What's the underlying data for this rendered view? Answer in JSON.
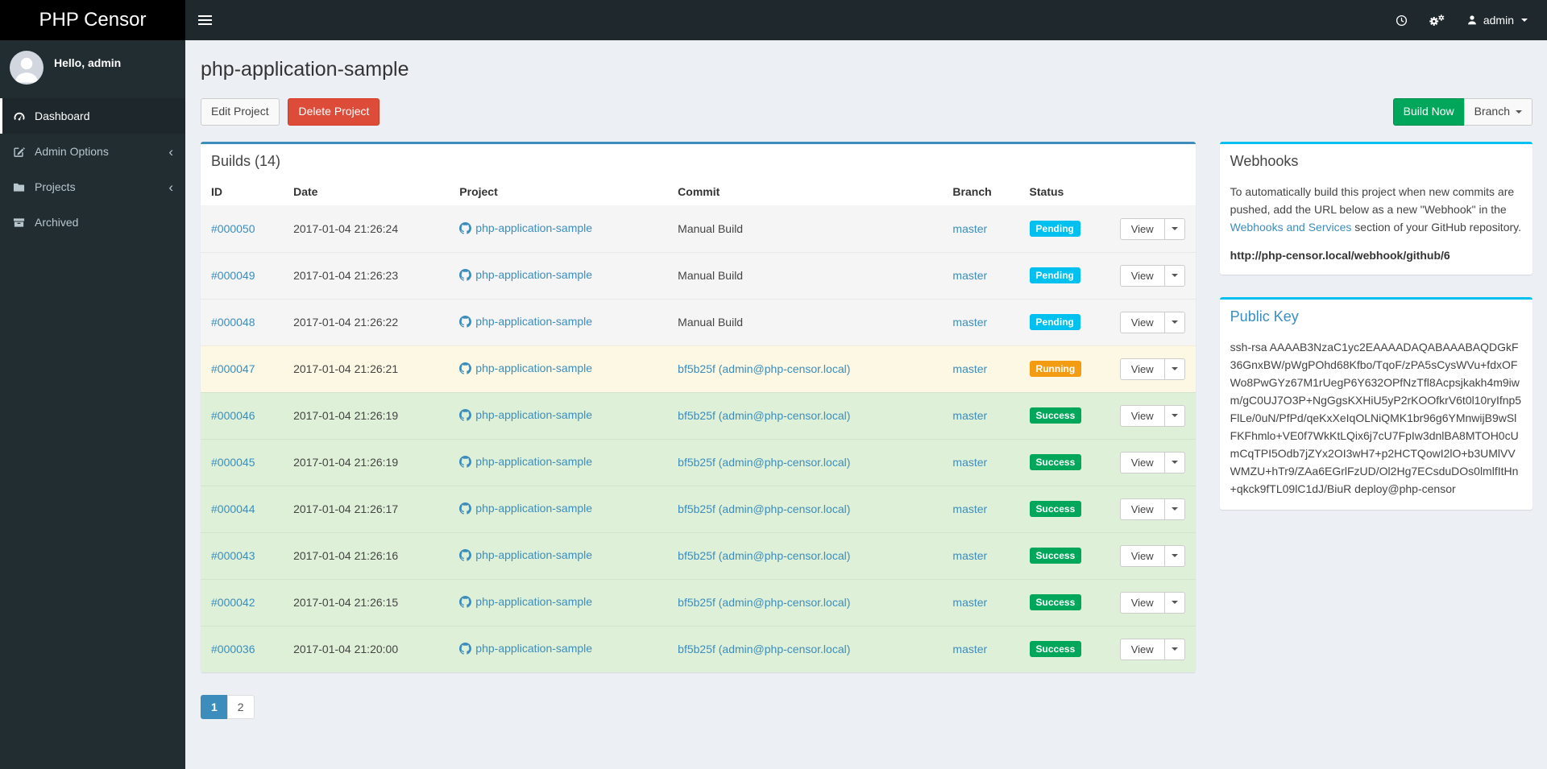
{
  "brand": {
    "title": "PHP Censor"
  },
  "navbar": {
    "user": "admin",
    "icons": [
      "clock-icon",
      "gears-icon",
      "user-icon"
    ]
  },
  "sidebar": {
    "greeting": "Hello, admin",
    "items": [
      {
        "label": "Dashboard",
        "icon": "dashboard-icon",
        "active": true,
        "chevron": false
      },
      {
        "label": "Admin Options",
        "icon": "edit-icon",
        "active": false,
        "chevron": true
      },
      {
        "label": "Projects",
        "icon": "folder-icon",
        "active": false,
        "chevron": true
      },
      {
        "label": "Archived",
        "icon": "archive-icon",
        "active": false,
        "chevron": false
      }
    ]
  },
  "page": {
    "title": "php-application-sample",
    "edit_button": "Edit Project",
    "delete_button": "Delete Project",
    "build_now_button": "Build Now",
    "branch_button": "Branch"
  },
  "builds": {
    "title": "Builds (14)",
    "columns": [
      "ID",
      "Date",
      "Project",
      "Commit",
      "Branch",
      "Status",
      ""
    ],
    "view_label": "View",
    "rows": [
      {
        "id": "#000050",
        "date": "2017-01-04 21:26:24",
        "project": "php-application-sample",
        "commit": "Manual Build",
        "commit_link": false,
        "branch": "master",
        "status": "Pending"
      },
      {
        "id": "#000049",
        "date": "2017-01-04 21:26:23",
        "project": "php-application-sample",
        "commit": "Manual Build",
        "commit_link": false,
        "branch": "master",
        "status": "Pending"
      },
      {
        "id": "#000048",
        "date": "2017-01-04 21:26:22",
        "project": "php-application-sample",
        "commit": "Manual Build",
        "commit_link": false,
        "branch": "master",
        "status": "Pending"
      },
      {
        "id": "#000047",
        "date": "2017-01-04 21:26:21",
        "project": "php-application-sample",
        "commit": "bf5b25f (admin@php-censor.local)",
        "commit_link": true,
        "branch": "master",
        "status": "Running"
      },
      {
        "id": "#000046",
        "date": "2017-01-04 21:26:19",
        "project": "php-application-sample",
        "commit": "bf5b25f (admin@php-censor.local)",
        "commit_link": true,
        "branch": "master",
        "status": "Success"
      },
      {
        "id": "#000045",
        "date": "2017-01-04 21:26:19",
        "project": "php-application-sample",
        "commit": "bf5b25f (admin@php-censor.local)",
        "commit_link": true,
        "branch": "master",
        "status": "Success"
      },
      {
        "id": "#000044",
        "date": "2017-01-04 21:26:17",
        "project": "php-application-sample",
        "commit": "bf5b25f (admin@php-censor.local)",
        "commit_link": true,
        "branch": "master",
        "status": "Success"
      },
      {
        "id": "#000043",
        "date": "2017-01-04 21:26:16",
        "project": "php-application-sample",
        "commit": "bf5b25f (admin@php-censor.local)",
        "commit_link": true,
        "branch": "master",
        "status": "Success"
      },
      {
        "id": "#000042",
        "date": "2017-01-04 21:26:15",
        "project": "php-application-sample",
        "commit": "bf5b25f (admin@php-censor.local)",
        "commit_link": true,
        "branch": "master",
        "status": "Success"
      },
      {
        "id": "#000036",
        "date": "2017-01-04 21:20:00",
        "project": "php-application-sample",
        "commit": "bf5b25f (admin@php-censor.local)",
        "commit_link": true,
        "branch": "master",
        "status": "Success"
      }
    ],
    "pagination": [
      {
        "label": "1",
        "active": true
      },
      {
        "label": "2",
        "active": false
      }
    ]
  },
  "webhooks": {
    "title": "Webhooks",
    "text_before": "To automatically build this project when new commits are pushed, add the URL below as a new \"Webhook\" in the ",
    "link_text": "Webhooks and Services",
    "text_after": " section of your GitHub repository.",
    "url": "http://php-censor.local/webhook/github/6"
  },
  "public_key": {
    "title": "Public Key",
    "key": "ssh-rsa AAAAB3NzaC1yc2EAAAADAQABAAABAQDGkF36GnxBW/pWgPOhd68Kfbo/TqoF/zPA5sCysWVu+fdxOFWo8PwGYz67M1rUegP6Y632OPfNzTfl8Acpsjkakh4m9iwm/gC0UJ7O3P+NgGgsKXHiU5yP2rKOOfkrV6t0l10ryIfnp5FlLe/0uN/PfPd/qeKxXeIqOLNiQMK1br96g6YMnwijB9wSlFKFhmlo+VE0f7WkKtLQix6j7cU7FpIw3dnlBA8MTOH0cUmCqTPI5Odb7jZYx2OI3wH7+p2HCTQowI2lO+b3UMlVVWMZU+hTr9/ZAa6EGrlFzUD/Ol2Hg7ECsduDOs0lmlfItHn+qkck9fTL09lC1dJ/BiuR deploy@php-censor"
  },
  "colors": {
    "accent": "#3c8dbc",
    "info": "#00c0ef",
    "warning": "#f39c12",
    "success": "#00a65a",
    "danger": "#dd4b39",
    "row_pending": "#f5f5f5",
    "row_running": "#fcf8e3",
    "row_success": "#dff0d8",
    "sidebar_bg": "#222d32",
    "navbar_bg": "#1f282d"
  }
}
